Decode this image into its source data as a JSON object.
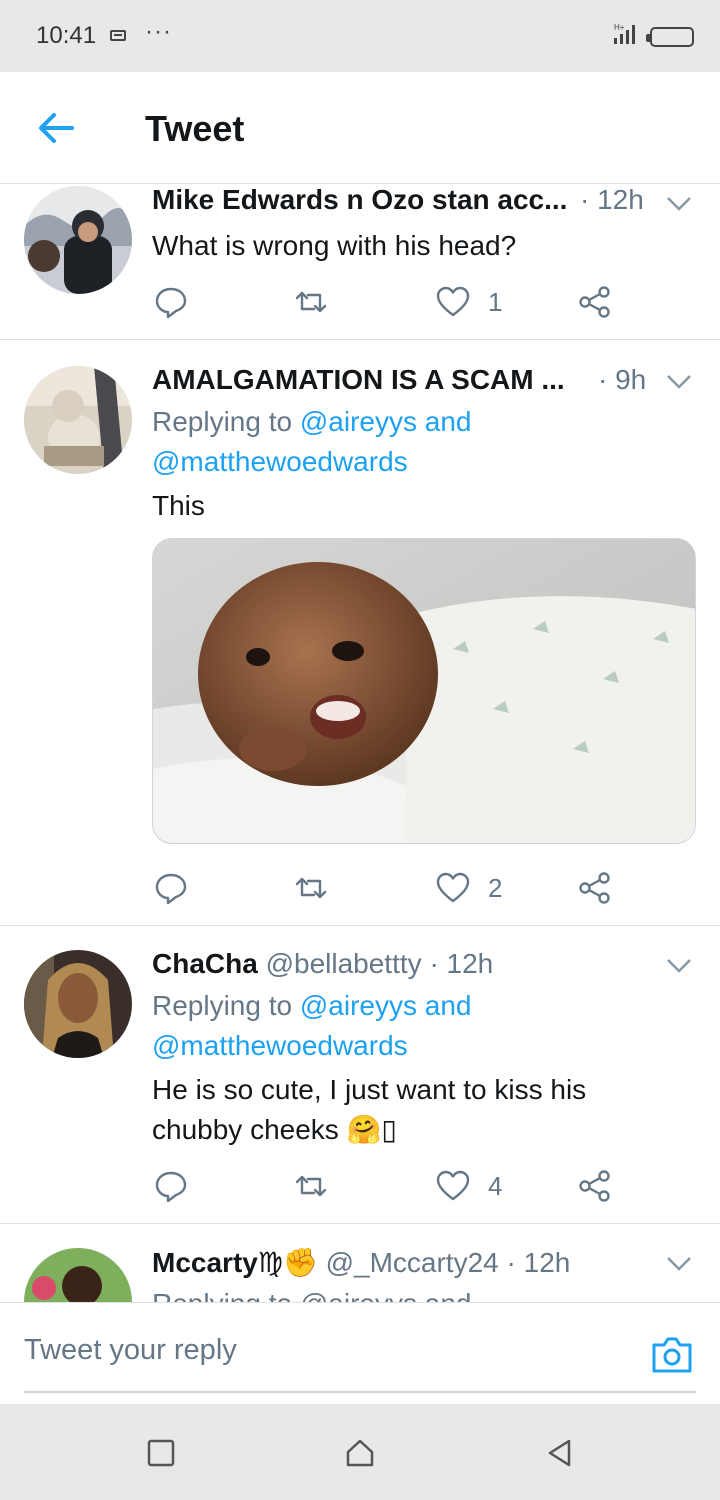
{
  "status_bar": {
    "time": "10:41",
    "dots": "···",
    "signal_badge": "H+"
  },
  "header": {
    "title": "Tweet",
    "back_icon": "arrow-left-icon",
    "accent_color": "#1da1f2"
  },
  "tweets": [
    {
      "name": "Mike Edwards n Ozo stan acc...",
      "time": "· 12h",
      "text": "What is wrong with his head?",
      "reply_count": "",
      "retweet_count": "",
      "like_count": "1"
    },
    {
      "name": "AMALGAMATION IS A SCAM ...",
      "time": "· 9h",
      "replying_prefix": "Replying to",
      "reply_mention_1": "@aireyys",
      "reply_and": "and",
      "reply_mention_2": "@matthewoedwards",
      "text": "This",
      "has_media": true,
      "like_count": "2"
    },
    {
      "name": "ChaCha",
      "handle": "@bellabettty",
      "time": "· 12h",
      "replying_prefix": "Replying to",
      "reply_mention_1": "@aireyys",
      "reply_and": "and",
      "reply_mention_2": "@matthewoedwards",
      "text_line_1": "He is so cute, I just want to kiss his",
      "text_line_2": "chubby cheeks 🤗▯",
      "like_count": "4"
    },
    {
      "name": "Mccarty",
      "name_emoji": "♍✊",
      "handle": "@_Mccarty24",
      "time": "· 12h",
      "replying_prefix": "Replying to @aireyys and"
    }
  ],
  "composer": {
    "placeholder": "Tweet your reply",
    "camera_icon": "camera-icon"
  },
  "nav": {
    "recents_icon": "square-icon",
    "home_icon": "house-icon",
    "back_icon": "triangle-back-icon"
  }
}
